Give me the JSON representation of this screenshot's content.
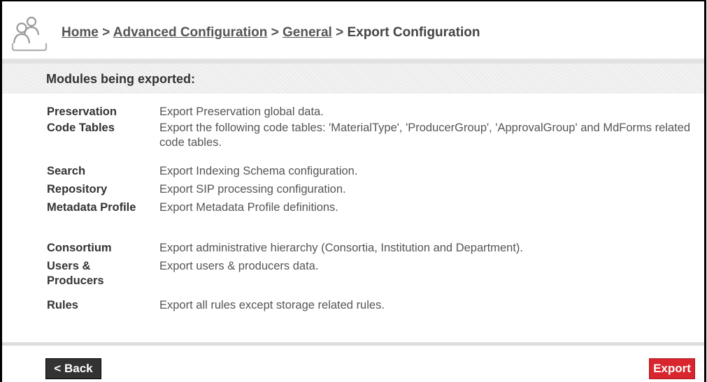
{
  "breadcrumb": {
    "home": "Home",
    "advanced": "Advanced Configuration",
    "general": "General",
    "current": "Export Configuration",
    "separator": ">"
  },
  "header": {
    "icon": "users-icon"
  },
  "section": {
    "title": "Modules being exported:"
  },
  "modules": [
    {
      "name": "Preservation",
      "description": "Export Preservation global data."
    },
    {
      "name": "Code Tables",
      "description": "Export the following code tables: 'MaterialType', 'ProducerGroup', 'ApprovalGroup' and MdForms related code tables."
    },
    {
      "name": "Search",
      "description": "Export Indexing Schema configuration."
    },
    {
      "name": "Repository",
      "description": "Export SIP processing configuration."
    },
    {
      "name": "Metadata Profile",
      "description": "Export Metadata Profile definitions."
    },
    {
      "name": "Consortium",
      "description": "Export administrative hierarchy (Consortia, Institution and Department)."
    },
    {
      "name": "Users & Producers",
      "description": "Export users & producers data."
    },
    {
      "name": "Rules",
      "description": "Export all rules except storage related rules."
    }
  ],
  "buttons": {
    "back_label": "< Back",
    "export_label": "Export"
  },
  "colors": {
    "export_button": "#d9252e",
    "back_button": "#333333",
    "text": "#333333"
  }
}
